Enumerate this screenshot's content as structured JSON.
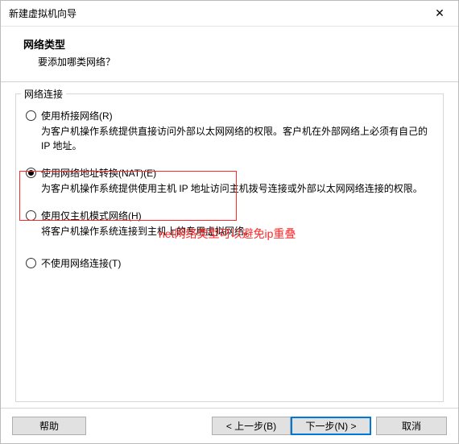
{
  "window": {
    "title": "新建虚拟机向导"
  },
  "header": {
    "heading": "网络类型",
    "subheading": "要添加哪类网络？"
  },
  "group": {
    "label": "网络连接",
    "options": {
      "bridged": {
        "label": "使用桥接网络(R)",
        "desc": "为客户机操作系统提供直接访问外部以太网网络的权限。客户机在外部网络上必须有自己的 IP 地址。"
      },
      "nat": {
        "label": "使用网络地址转换(NAT)(E)",
        "desc": "为客户机操作系统提供使用主机 IP 地址访问主机拨号连接或外部以太网网络连接的权限。"
      },
      "hostonly": {
        "label": "使用仅主机模式网络(H)",
        "desc": "将客户机操作系统连接到主机上的专用虚拟网络。"
      },
      "none": {
        "label": "不使用网络连接(T)"
      }
    }
  },
  "annotation": {
    "text": "net网络类型可以避免ip重叠"
  },
  "buttons": {
    "help": "帮助",
    "back": "< 上一步(B)",
    "next": "下一步(N) >",
    "cancel": "取消"
  }
}
